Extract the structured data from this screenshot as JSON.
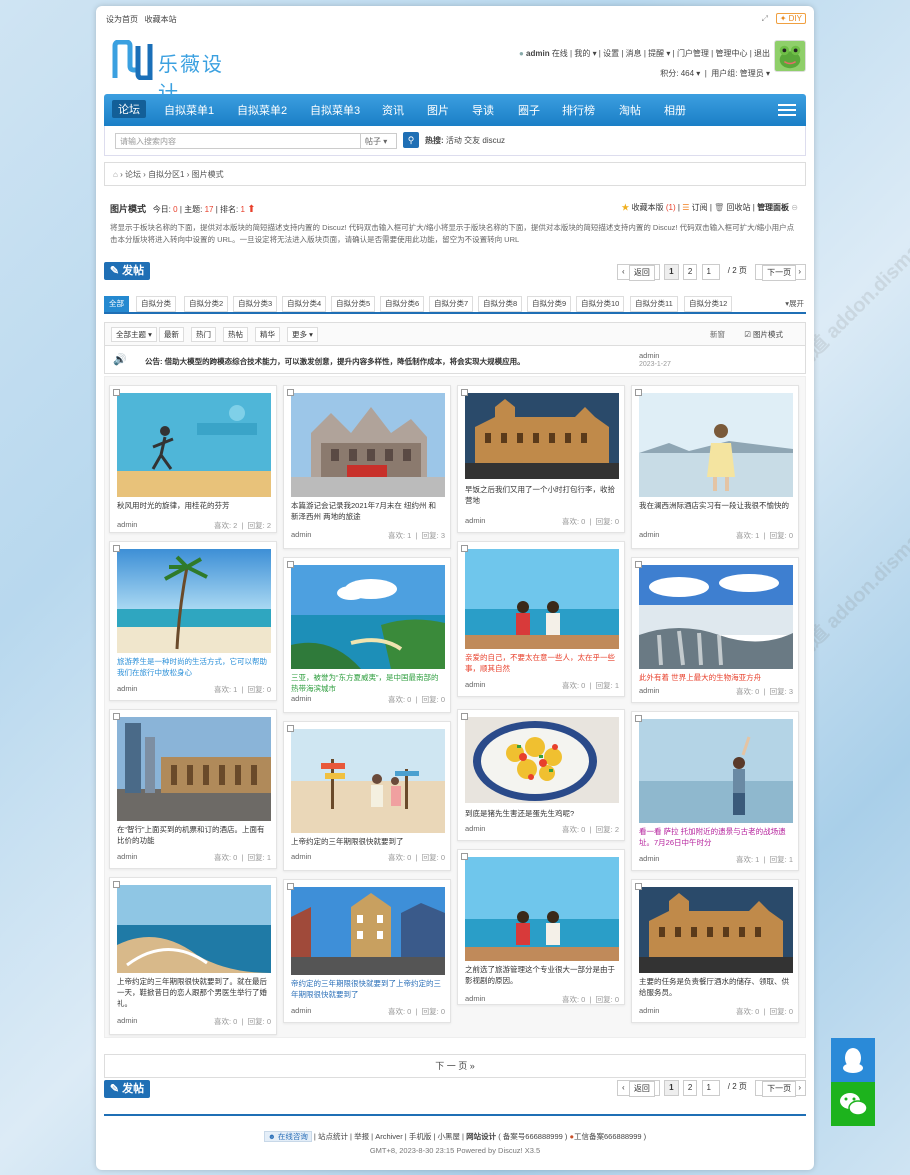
{
  "topbar": {
    "home": "设为首页",
    "fav": "收藏本站",
    "diy": "DIY"
  },
  "logo": {
    "text": "乐薇设计"
  },
  "user": {
    "name": "admin",
    "status": "在线",
    "links": [
      "我的",
      "设置",
      "消息",
      "提醒",
      "门户管理",
      "管理中心",
      "退出"
    ],
    "points_label": "积分: 464",
    "group_label": "用户组: 管理员"
  },
  "nav": {
    "items": [
      "论坛",
      "自拟菜单1",
      "自拟菜单2",
      "自拟菜单3",
      "资讯",
      "图片",
      "导读",
      "圈子",
      "排行榜",
      "淘帖",
      "相册"
    ]
  },
  "search": {
    "placeholder": "请输入搜索内容",
    "type": "帖子",
    "hot_label": "热搜:",
    "hot": [
      "活动",
      "交友",
      "discuz"
    ]
  },
  "breadcrumb": [
    "论坛",
    "自拟分区1",
    "图片模式"
  ],
  "forum": {
    "name": "图片模式",
    "today_label": "今日:",
    "today": "0",
    "topics_label": "主题:",
    "topics": "17",
    "rank_label": "排名:",
    "rank": "1",
    "fav": "收藏本版",
    "fav_count": "(1)",
    "rss": "订阅",
    "recycle": "回收站",
    "panel": "管理面板",
    "desc": "将显示于板块名称的下面，提供对本版块的简短描述支持内置的 Discuz! 代码双击输入框可扩大/缩小将显示于版块名称的下面，提供对本版块的简短描述支持内置的 Discuz! 代码双击输入框可扩大/缩小用户点击本分版块将进入转向中设置的 URL。一旦设定将无法进入版块页面，请确认是否需要使用此功能，留空为不设置转向 URL"
  },
  "post_label": "发帖",
  "pager": {
    "back": "返回",
    "p1": "1",
    "p2": "2",
    "input": "1",
    "total": "/ 2 页",
    "next": "下一页"
  },
  "categories": [
    "全部",
    "自拟分类",
    "自拟分类2",
    "自拟分类3",
    "自拟分类4",
    "自拟分类5",
    "自拟分类6",
    "自拟分类7",
    "自拟分类8",
    "自拟分类9",
    "自拟分类10",
    "自拟分类11",
    "自拟分类12"
  ],
  "expand": "展开",
  "filters": [
    "全部主题",
    "最新",
    "热门",
    "热帖",
    "精华",
    "更多"
  ],
  "view": {
    "new": "新窗",
    "image_mode": "图片模式"
  },
  "notice": {
    "text": "公告: 借助大模型的跨模态综合技术能力，可以激发创意，提升内容多样性，降低制作成本，将会实现大规模应用。",
    "author": "admin",
    "date": "2023-1-27"
  },
  "card_labels": {
    "likes": "喜欢:",
    "replies": "回复:"
  },
  "cards": [
    {
      "title": "秋风用时光的旋律，用桂花的芬芳",
      "author": "admin",
      "likes": "2",
      "replies": "2",
      "color": "#333"
    },
    {
      "title": "本篇游记会记录我2021年7月末在 纽约州 和 新泽西州 两地的旅途",
      "author": "admin",
      "likes": "1",
      "replies": "3",
      "color": "#333"
    },
    {
      "title": "早饭之后我们又用了一个小时打包行李，收拾营地",
      "author": "admin",
      "likes": "0",
      "replies": "0",
      "color": "#333"
    },
    {
      "title": "我在澜西洲际酒店实习有一段让我很不愉快的",
      "author": "admin",
      "likes": "1",
      "replies": "0",
      "color": "#333"
    },
    {
      "title": "旅游养生是一种时尚的生活方式，它可以帮助我们在旅行中放松身心",
      "author": "admin",
      "likes": "1",
      "replies": "0",
      "color": "#2a8fd8"
    },
    {
      "title": "三亚，被誉为“东方夏威夷”，是中国最南部的热带海滨城市",
      "author": "admin",
      "likes": "0",
      "replies": "0",
      "color": "#2e9e3e"
    },
    {
      "title": "亲爱的自己，不要太在意一些人，太在乎一些事，顺其自然",
      "author": "admin",
      "likes": "0",
      "replies": "1",
      "color": "#e8402c"
    },
    {
      "title": "此外有着 世界上最大的生物海亚方舟",
      "author": "admin",
      "likes": "0",
      "replies": "3",
      "color": "#e8402c"
    },
    {
      "title": "在“智行”上面买到的机票和订的酒店。上面有比价的功能",
      "author": "admin",
      "likes": "0",
      "replies": "1",
      "color": "#333"
    },
    {
      "title": "上帝约定的三年期限很快就要到了",
      "author": "admin",
      "likes": "0",
      "replies": "0",
      "color": "#333"
    },
    {
      "title": "到底是猪先生害还是蛋先生鸡呢?",
      "author": "admin",
      "likes": "0",
      "replies": "2",
      "color": "#333"
    },
    {
      "title": "看一看 萨拉 托加附近的遗景与古老的战场遗址。7月26日中午时分",
      "author": "admin",
      "likes": "1",
      "replies": "1",
      "color": "#b5209c"
    },
    {
      "title": "上帝约定的三年期限很快就要到了。就在最后一天，鞋掀昔日的恋人跟那个男医生举行了婚礼。",
      "author": "admin",
      "likes": "0",
      "replies": "0",
      "color": "#333"
    },
    {
      "title": "帝约定的三年期限很快就要到了上帝约定的三年期限很快就要到了",
      "author": "admin",
      "likes": "0",
      "replies": "0",
      "color": "#2a6fb8"
    },
    {
      "title": "之前选了旅游管理这个专业很大一部分是由于影视剧的原因。",
      "author": "admin",
      "likes": "0",
      "replies": "0",
      "color": "#333"
    },
    {
      "title": "主要的任务是负责餐厅酒水的储存、领取、供给服务员。",
      "author": "admin",
      "likes": "0",
      "replies": "0",
      "color": "#333"
    }
  ],
  "next_page": "下 一 页  »",
  "footer": {
    "consult": "在线咨询",
    "links": [
      "站点统计",
      "举报",
      "Archiver",
      "手机版",
      "小黑屋"
    ],
    "site": "网站设计",
    "icp": "( 备案号666888999 )",
    "police": "工信备案666888999 )",
    "powered": "GMT+8, 2023-8-30 23:15 Powered by Discuz! X3.5"
  },
  "watermark": "DISCUZ!应用中心  贰道  addon.dismall.com"
}
